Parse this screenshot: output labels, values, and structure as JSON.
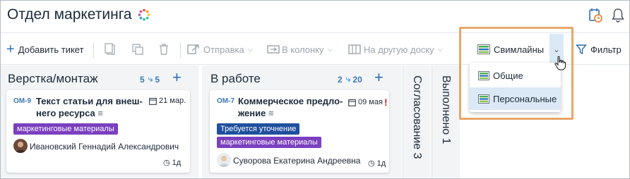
{
  "header": {
    "title": "Отдел маркетинга",
    "icons": [
      "loading-spinner",
      "calendar-history-icon",
      "bell-icon"
    ]
  },
  "toolbar": {
    "add_ticket": "Добавить тикет",
    "send": "Отправка",
    "to_column": "В колонку",
    "to_other_board": "На другую доску",
    "swimlanes": "Свимлайны",
    "filter": "Фильтр"
  },
  "swimlanes_menu": {
    "options": [
      "Общие",
      "Персональные"
    ],
    "hovered": "Персональные"
  },
  "columns": [
    {
      "title": "Верстка/монтаж",
      "count": "5",
      "sub_count": "5",
      "cards": [
        {
          "id": "OM-9",
          "title_line1": "Текст статьи для внеш-",
          "title_line2": "него ресурса",
          "date": "21 мар.",
          "tags": [
            {
              "label": "маркетинговые материалы",
              "color": "#7b3fbf"
            }
          ],
          "assignee": "Ивановский Геннадий Александрович",
          "estimate": "1д"
        }
      ]
    },
    {
      "title": "В работе",
      "count": "2",
      "sub_count": "20",
      "cards": [
        {
          "id": "OM-7",
          "title_line1": "Коммерческое предло-",
          "title_line2": "жение",
          "date": "09 мая",
          "urgent": "!",
          "tags": [
            {
              "label": "Требуется уточнение",
              "color": "#1f4f9e"
            },
            {
              "label": "маркетинговые материалы",
              "color": "#7b3fbf"
            }
          ],
          "assignee": "Суворова Екатерина Андреевна",
          "estimate": "1д"
        }
      ]
    },
    {
      "title": "Согласование",
      "count": "3"
    },
    {
      "title": "Выполнено",
      "count": "1"
    }
  ],
  "colors": {
    "accent": "#2f6fb3",
    "highlight": "#e8a66a",
    "tag_purple": "#7b3fbf",
    "tag_blue": "#1f4f9e",
    "urgent": "#d6262b"
  }
}
